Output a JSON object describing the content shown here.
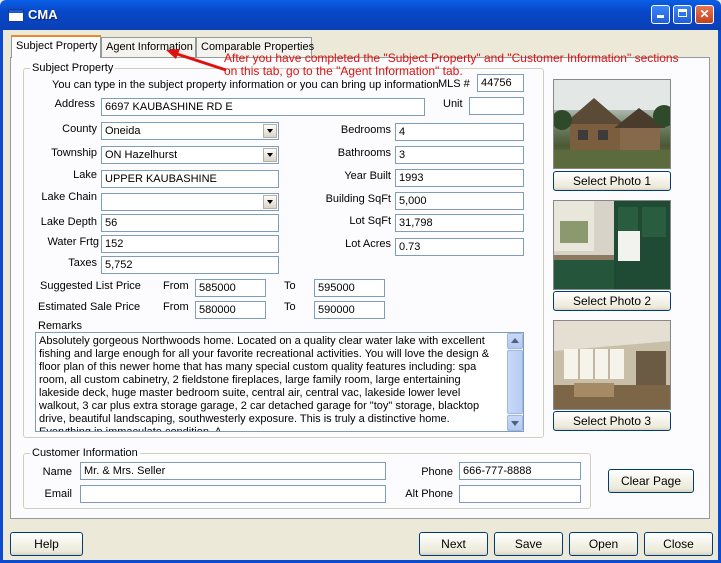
{
  "window": {
    "title": "CMA"
  },
  "tabs": [
    {
      "label": "Subject Property"
    },
    {
      "label": "Agent Information"
    },
    {
      "label": "Comparable Properties"
    }
  ],
  "annotation": {
    "line1": "After you have completed the \"Subject Property\" and \"Customer Information\" sections",
    "line2": "on this tab, go to the \"Agent Information\" tab.",
    "color": "#e01010"
  },
  "subject": {
    "group_label": "Subject Property",
    "intro": "You can type in the subject property information or you can bring up information",
    "mls_label": "MLS #",
    "mls": "44756",
    "address_label": "Address",
    "address": "6697 KAUBASHINE RD E",
    "unit_label": "Unit",
    "unit": "",
    "county_label": "County",
    "county": "Oneida",
    "township_label": "Township",
    "township": "ON Hazelhurst",
    "lake_label": "Lake",
    "lake": "UPPER KAUBASHINE",
    "lake_chain_label": "Lake Chain",
    "lake_chain": "",
    "lake_depth_label": "Lake Depth",
    "lake_depth": "56",
    "water_frtg_label": "Water Frtg",
    "water_frtg": "152",
    "taxes_label": "Taxes",
    "taxes": "5,752",
    "bedrooms_label": "Bedrooms",
    "bedrooms": "4",
    "bathrooms_label": "Bathrooms",
    "bathrooms": "3",
    "year_built_label": "Year Built",
    "year_built": "1993",
    "building_sqft_label": "Building SqFt",
    "building_sqft": "5,000",
    "lot_sqft_label": "Lot SqFt",
    "lot_sqft": "31,798",
    "lot_acres_label": "Lot Acres",
    "lot_acres": "0.73",
    "suggested_label": "Suggested List Price",
    "estimated_label": "Estimated Sale Price",
    "from_label": "From",
    "to_label": "To",
    "suggested_from": "585000",
    "suggested_to": "595000",
    "estimated_from": "580000",
    "estimated_to": "590000",
    "remarks_label": "Remarks",
    "remarks": "Absolutely gorgeous Northwoods home. Located on a quality clear water lake with excellent fishing and large enough for all your favorite recreational activities. You will love the design & floor plan of this newer home that has many special custom quality features including: spa room, all custom cabinetry, 2 fieldstone fireplaces, large family room, large entertaining lakeside deck, huge master bedroom suite, central air, central vac, lakeside lower level walkout, 3 car plus extra storage garage, 2 car detached garage for \"toy\" storage, blacktop drive, beautiful landscaping, southwesterly exposure. This is truly a distinctive home. Everything in immaculate condition. A"
  },
  "photos": [
    {
      "button": "Select Photo 1"
    },
    {
      "button": "Select Photo 2"
    },
    {
      "button": "Select Photo 3"
    }
  ],
  "customer": {
    "group_label": "Customer Information",
    "name_label": "Name",
    "name": "Mr. & Mrs. Seller",
    "email_label": "Email",
    "email": "",
    "phone_label": "Phone",
    "phone": "666-777-8888",
    "alt_phone_label": "Alt Phone",
    "alt_phone": "",
    "clear_button": "Clear Page"
  },
  "footer": {
    "help": "Help",
    "next": "Next",
    "save": "Save",
    "open": "Open",
    "close": "Close"
  }
}
